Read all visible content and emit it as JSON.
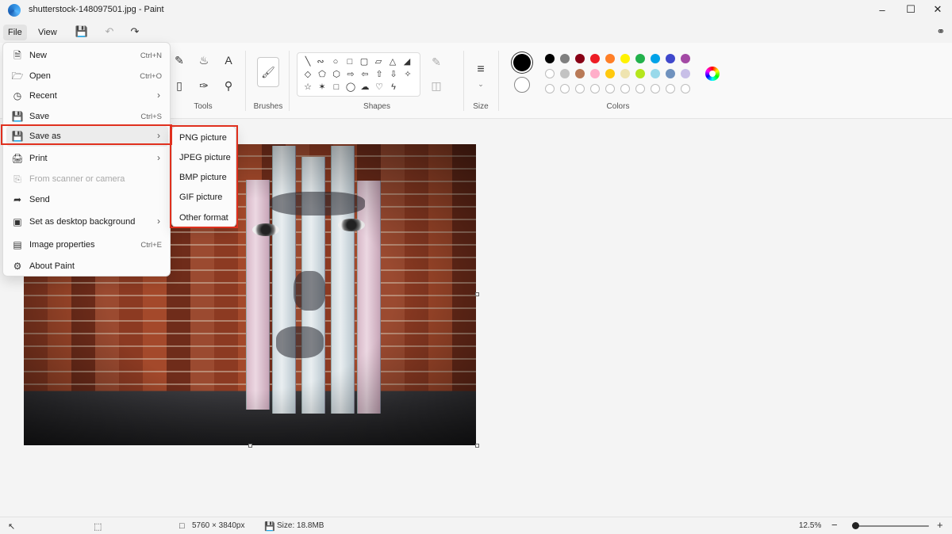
{
  "window": {
    "title": "shutterstock-148097501.jpg - Paint"
  },
  "menubar": {
    "file_label": "File",
    "view_label": "View"
  },
  "ribbon": {
    "groups": {
      "tools": "Tools",
      "brushes": "Brushes",
      "shapes": "Shapes",
      "size": "Size",
      "colors": "Colors"
    },
    "text_tool_glyph": "A",
    "primary_color": "#000000",
    "secondary_color": "#ffffff",
    "palette_row1": [
      "#000000",
      "#7f7f7f",
      "#880015",
      "#ed1c24",
      "#ff7f27",
      "#fff200",
      "#22b14c",
      "#00a2e8",
      "#3f48cc",
      "#a349a4"
    ],
    "palette_row2": [
      "#ffffff",
      "#c3c3c3",
      "#b97a57",
      "#ffaec9",
      "#ffc90e",
      "#efe4b0",
      "#b5e61d",
      "#99d9ea",
      "#7092be",
      "#c8bfe7"
    ]
  },
  "file_menu": {
    "items": [
      {
        "label": "New",
        "shortcut": "Ctrl+N",
        "icon": "new-file-icon"
      },
      {
        "label": "Open",
        "shortcut": "Ctrl+O",
        "icon": "folder-icon"
      },
      {
        "label": "Recent",
        "shortcut": "",
        "icon": "clock-icon"
      },
      {
        "label": "Save",
        "shortcut": "Ctrl+S",
        "icon": "save-icon"
      },
      {
        "label": "Save as",
        "shortcut": "",
        "icon": "save-as-icon"
      },
      {
        "label": "Print",
        "shortcut": "",
        "icon": "printer-icon"
      },
      {
        "label": "From scanner or camera",
        "shortcut": "",
        "icon": "scanner-icon"
      },
      {
        "label": "Send",
        "shortcut": "",
        "icon": "share-icon"
      },
      {
        "label": "Set as desktop background",
        "shortcut": "",
        "icon": "desktop-icon"
      },
      {
        "label": "Image properties",
        "shortcut": "Ctrl+E",
        "icon": "image-properties-icon"
      },
      {
        "label": "About Paint",
        "shortcut": "",
        "icon": "gear-icon"
      }
    ]
  },
  "save_as_submenu": {
    "items": [
      "PNG picture",
      "JPEG picture",
      "BMP picture",
      "GIF picture",
      "Other format"
    ]
  },
  "statusbar": {
    "dimensions": "5760 × 3840px",
    "size": "Size: 18.8MB",
    "zoom": "12.5%",
    "zoom_level": 0.03
  }
}
